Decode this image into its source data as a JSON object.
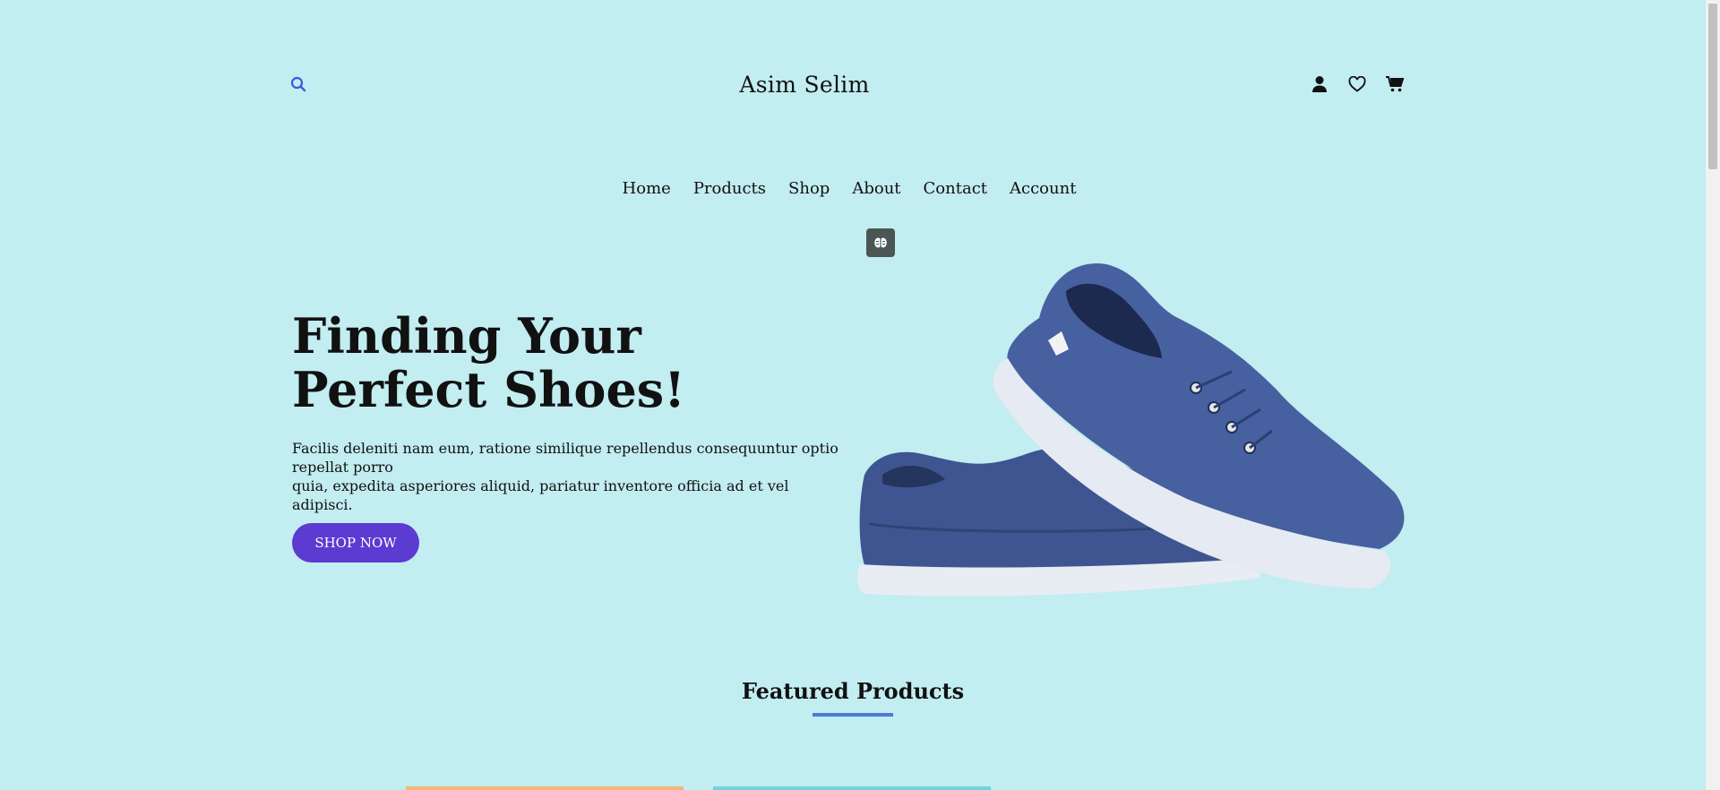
{
  "header": {
    "brand": "Asim Selim",
    "icons": [
      "search-icon",
      "user-icon",
      "heart-icon",
      "cart-icon"
    ]
  },
  "nav": {
    "items": [
      "Home",
      "Products",
      "Shop",
      "About",
      "Contact",
      "Account"
    ]
  },
  "hero": {
    "title_line1": "Finding Your",
    "title_line2": "Perfect Shoes!",
    "text_line1": "Facilis deleniti nam eum, ratione similique repellendus consequuntur optio repellat porro",
    "text_line2": "quia, expedita asperiores aliquid, pariatur inventore officia ad et vel adipisci.",
    "button": "SHOP NOW"
  },
  "featured": {
    "title": "Featured Products"
  },
  "colors": {
    "background": "#c2edf1",
    "accent": "#5b3bd1",
    "search_icon": "#3b5bdb",
    "underline": "#4c7ad6",
    "shoe": "#3d5593"
  }
}
